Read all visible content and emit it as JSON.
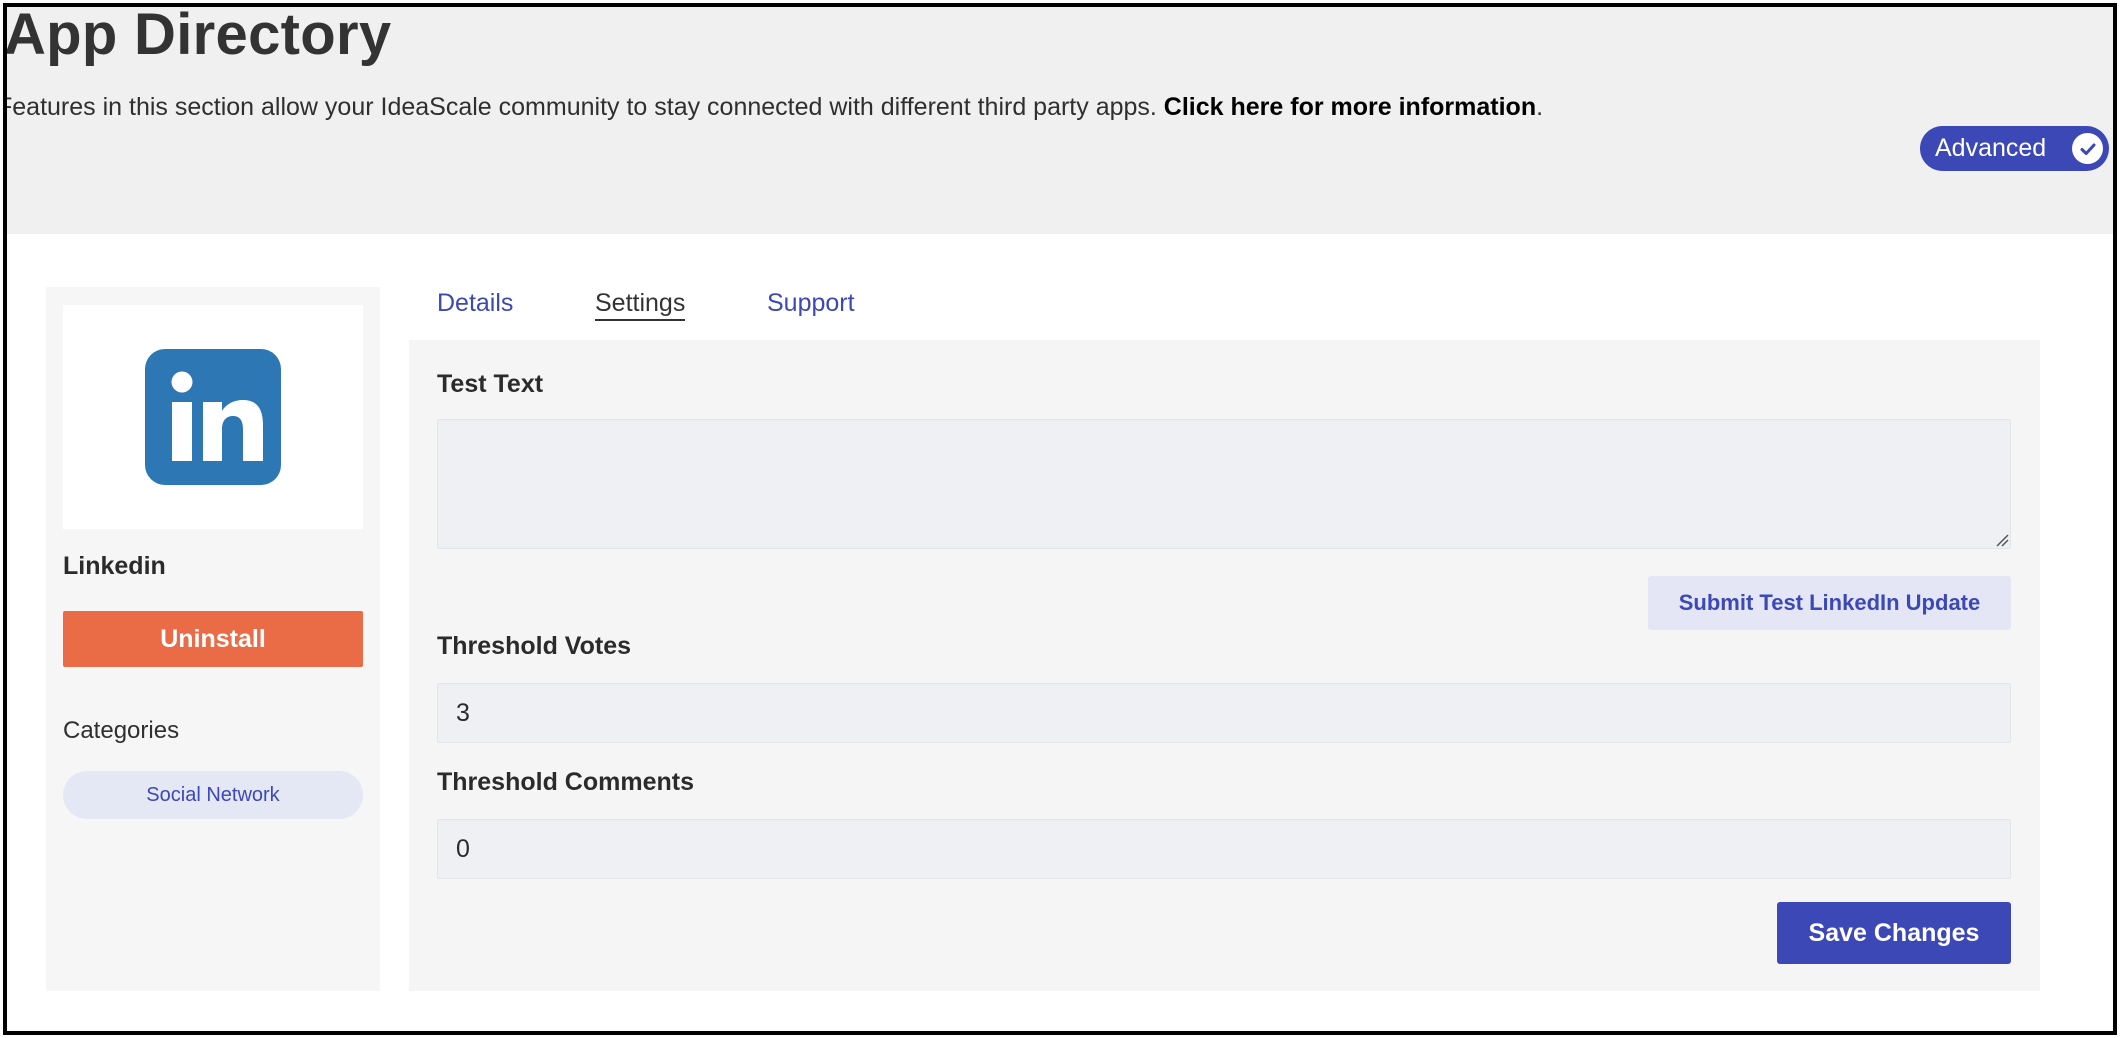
{
  "header": {
    "title": "App Directory",
    "intro_text": "Features in this section allow your IdeaScale community to stay connected with different third party apps. ",
    "intro_link": "Click here for more information",
    "intro_end": ".",
    "badge_label": "Advanced"
  },
  "app": {
    "name": "Linkedin",
    "logo_text": "in",
    "uninstall_label": "Uninstall",
    "categories_label": "Categories",
    "categories": [
      "Social Network"
    ]
  },
  "tabs": [
    {
      "label": "Details",
      "active": false
    },
    {
      "label": "Settings",
      "active": true
    },
    {
      "label": "Support",
      "active": false
    }
  ],
  "settings": {
    "test_text_label": "Test Text",
    "test_text_value": "",
    "submit_test_label": "Submit Test LinkedIn Update",
    "threshold_votes_label": "Threshold Votes",
    "threshold_votes_value": "3",
    "threshold_comments_label": "Threshold Comments",
    "threshold_comments_value": "0",
    "save_label": "Save Changes"
  },
  "colors": {
    "accent": "#3b48b5",
    "danger": "#e96c46",
    "linkedin": "#2e77b5"
  },
  "icons": {
    "badge": "check-circle-icon",
    "logo": "linkedin-logo-icon"
  }
}
